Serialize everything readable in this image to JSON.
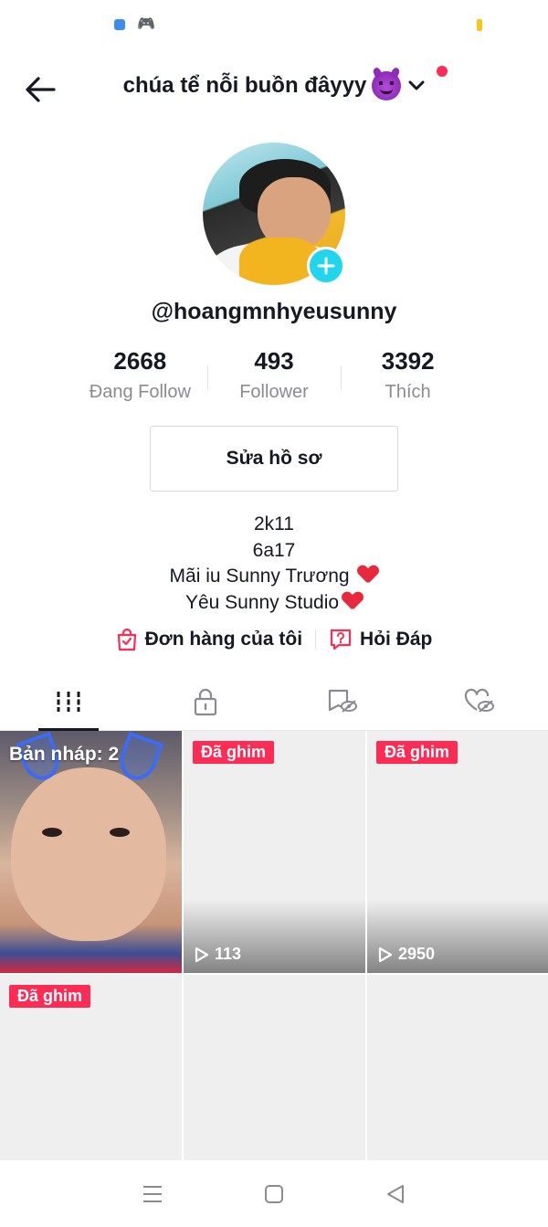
{
  "header": {
    "account_name": "chúa tể nỗi buồn đâyyy",
    "account_emoji": "smiling-devil-emoji"
  },
  "profile": {
    "username": "@hoangmnhyeusunny",
    "stats": [
      {
        "value": "2668",
        "label": "Đang Follow"
      },
      {
        "value": "493",
        "label": "Follower"
      },
      {
        "value": "3392",
        "label": "Thích"
      }
    ],
    "edit_button": "Sửa hồ sơ",
    "bio_lines": [
      "2k11",
      "6a17",
      "Mãi iu Sunny Trương",
      "Yêu Sunny Studio"
    ]
  },
  "links": {
    "orders": "Đơn hàng của tôi",
    "qa": "Hỏi Đáp"
  },
  "tabs": [
    "videos-grid-icon",
    "private-lock-icon",
    "hidden-bookmark-icon",
    "liked-hidden-heart-icon"
  ],
  "videos": {
    "draft_label": "Bản nháp: 2",
    "pinned_label": "Đã ghim",
    "items": [
      {
        "views": "113"
      },
      {
        "views": "2950"
      }
    ]
  },
  "colors": {
    "accent_red": "#fe2c55",
    "story_add": "#20d5ec",
    "text_primary": "#161823",
    "text_secondary": "#8a8b91"
  }
}
